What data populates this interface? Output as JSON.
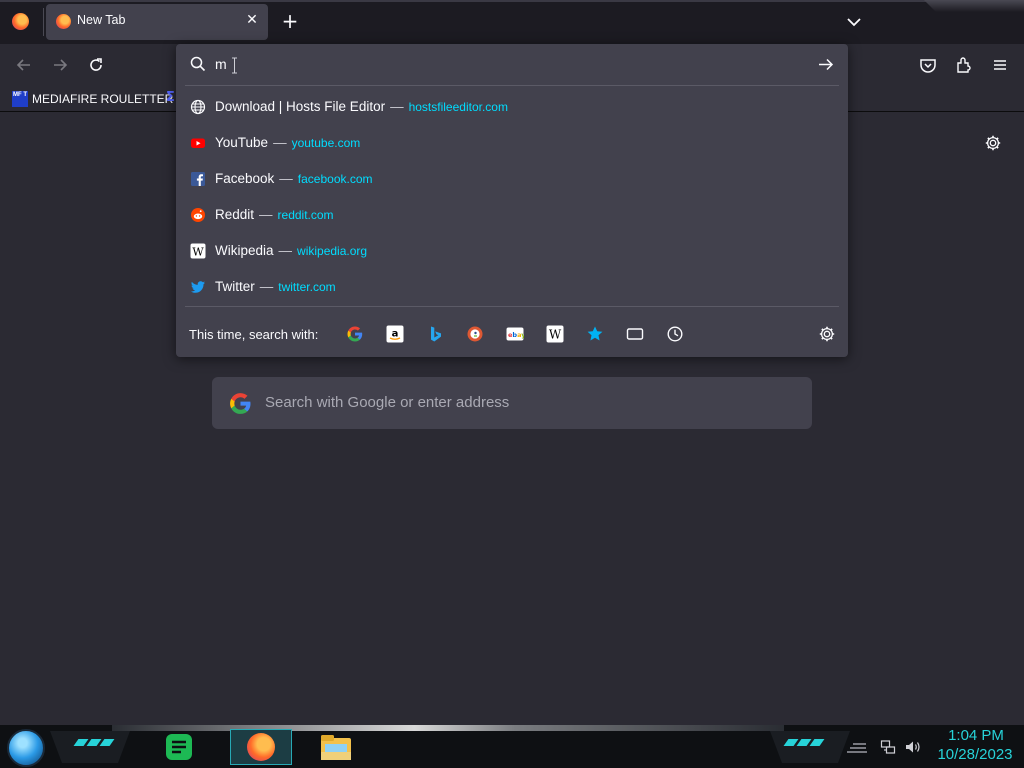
{
  "browser": {
    "tab": {
      "title": "New Tab"
    },
    "bookmarks": [
      {
        "label": "MEDIAFIRE ROULETTER",
        "icon_text": "MF T"
      }
    ]
  },
  "urlbar": {
    "value": "m",
    "results": [
      {
        "title": "Download | Hosts File Editor",
        "url": "hostsfileeditor.com",
        "icon": "globe-icon"
      },
      {
        "title": "YouTube",
        "url": "youtube.com",
        "icon": "youtube-icon"
      },
      {
        "title": "Facebook",
        "url": "facebook.com",
        "icon": "facebook-icon"
      },
      {
        "title": "Reddit",
        "url": "reddit.com",
        "icon": "reddit-icon"
      },
      {
        "title": "Wikipedia",
        "url": "wikipedia.org",
        "icon": "wikipedia-icon"
      },
      {
        "title": "Twitter",
        "url": "twitter.com",
        "icon": "twitter-icon"
      }
    ],
    "separator": "—",
    "oneoff_label": "This time, search with:",
    "oneoff_engines": [
      "google-icon",
      "amazon-icon",
      "bing-icon",
      "duckduckgo-icon",
      "ebay-icon",
      "wikipedia-icon",
      "bookmarks-icon",
      "tabs-icon",
      "history-icon"
    ]
  },
  "newtab": {
    "search_placeholder": "Search with Google or enter address"
  },
  "taskbar": {
    "time": "1:04 PM",
    "date": "10/28/2023",
    "accent": "#27d3d9"
  },
  "colors": {
    "toolbar": "#2b2a33",
    "panel": "#42414d",
    "url_text": "#00ddff"
  }
}
